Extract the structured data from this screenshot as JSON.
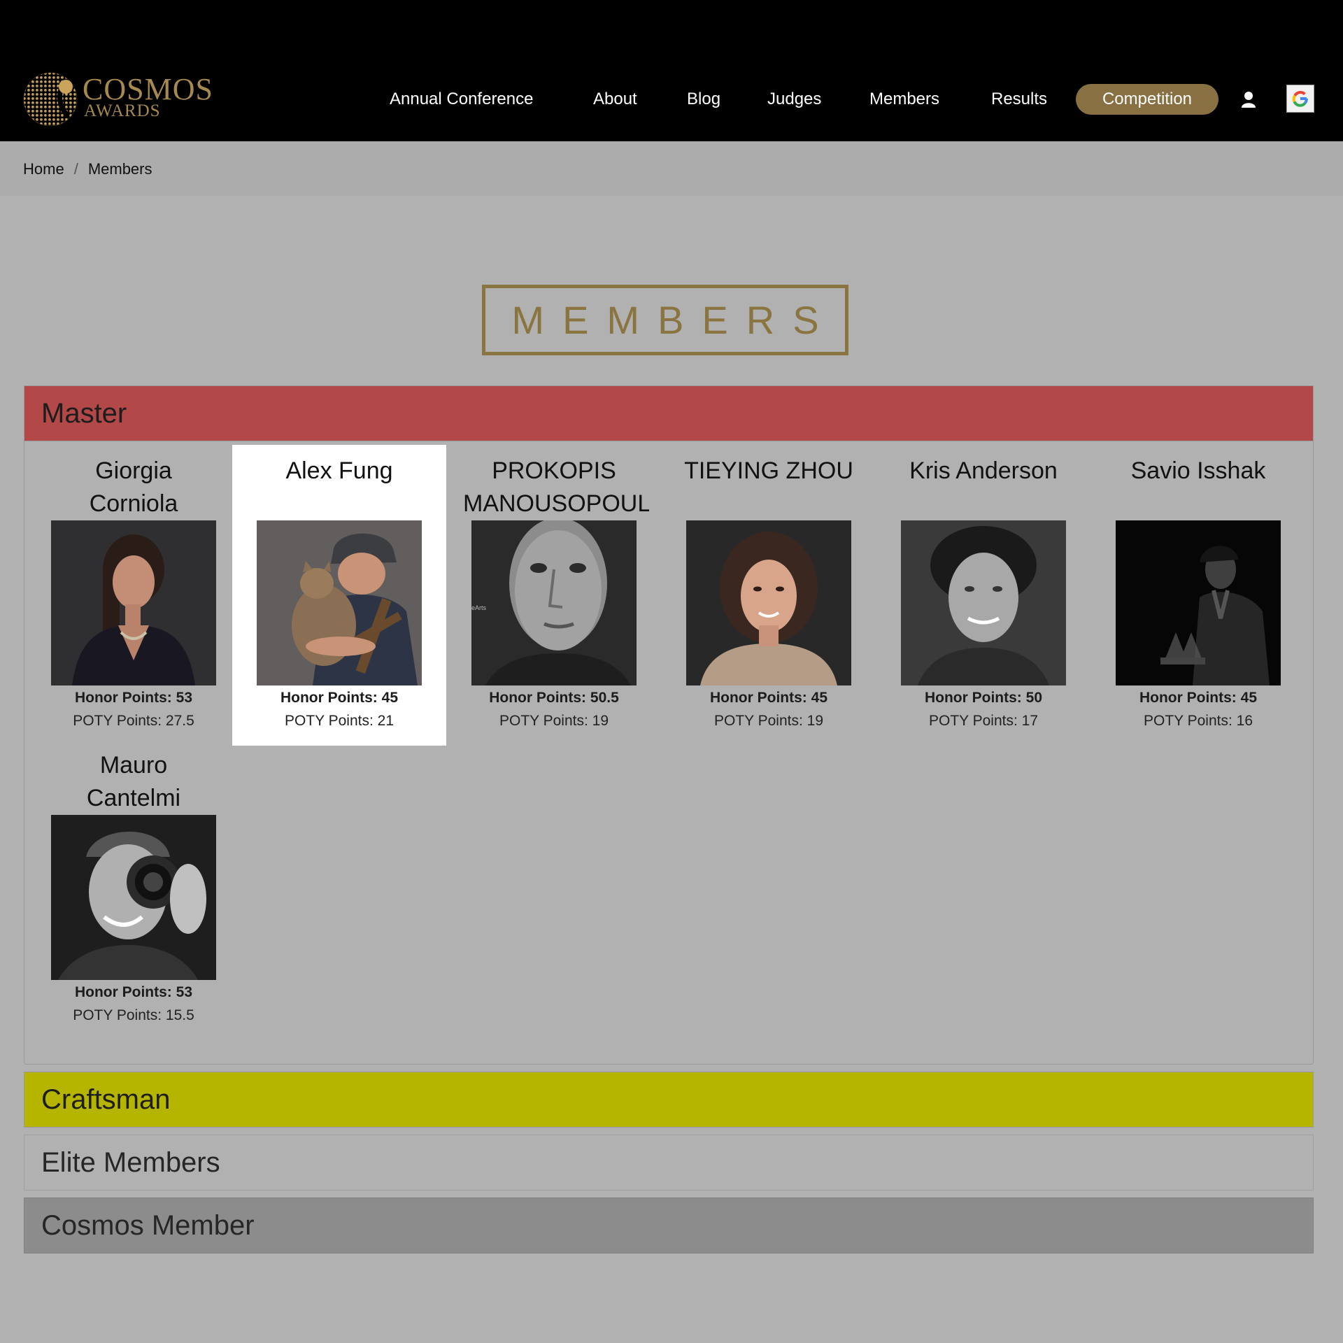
{
  "header": {
    "logo_line1": "COSMOS",
    "logo_line2": "AWARDS",
    "nav": [
      "Annual Conference",
      "About",
      "Blog",
      "Judges",
      "Members",
      "Results"
    ],
    "cta_label": "Competition",
    "user_icon": "user-icon",
    "google_icon": "google-icon"
  },
  "breadcrumb": {
    "home": "Home",
    "separator": "/",
    "current": "Members"
  },
  "page_title": "MEMBERS",
  "sections": [
    {
      "label": "Master",
      "color": "#b24848",
      "expanded": true
    },
    {
      "label": "Craftsman",
      "color": "#b5b500",
      "expanded": false
    },
    {
      "label": "Elite Members",
      "color": "#b1b1b1",
      "expanded": false
    },
    {
      "label": "Cosmos Member",
      "color": "#8c8c8c",
      "expanded": false
    }
  ],
  "members": [
    {
      "name_line1": "Giorgia",
      "name_line2": "Corniola",
      "honor": "Honor Points: 53",
      "poty": "POTY Points: 27.5"
    },
    {
      "name_line1": "Alex Fung",
      "name_line2": "",
      "honor": "Honor Points: 45",
      "poty": "POTY Points: 21"
    },
    {
      "name_line1": "PROKOPIS",
      "name_line2": "MANOUSOPOULOS",
      "honor": "Honor Points: 50.5",
      "poty": "POTY Points: 19"
    },
    {
      "name_line1": "TIEYING ZHOU",
      "name_line2": "",
      "honor": "Honor Points: 45",
      "poty": "POTY Points: 19"
    },
    {
      "name_line1": "Kris Anderson",
      "name_line2": "",
      "honor": "Honor Points: 50",
      "poty": "POTY Points: 17"
    },
    {
      "name_line1": "Savio Isshak",
      "name_line2": "",
      "honor": "Honor Points: 45",
      "poty": "POTY Points: 16"
    },
    {
      "name_line1": "Mauro",
      "name_line2": "Cantelmi",
      "honor": "Honor Points: 53",
      "poty": "POTY Points: 15.5"
    }
  ]
}
